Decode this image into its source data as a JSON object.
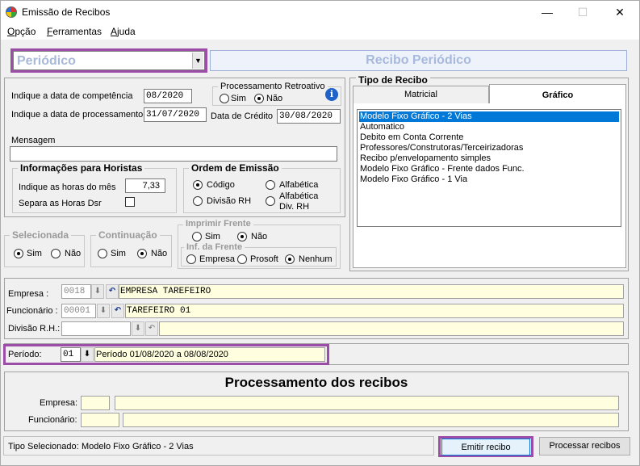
{
  "window": {
    "title": "Emissão de Recibos",
    "minimize": "—",
    "maximize": "☐",
    "close": "✕"
  },
  "menu": {
    "items": [
      {
        "label": "Opção"
      },
      {
        "label": "Ferramentas"
      },
      {
        "label": "Ajuda"
      }
    ]
  },
  "type_combo": {
    "value": "Periódico",
    "arrow": "▼"
  },
  "banner": "Recibo Periódico",
  "dates": {
    "competencia_label": "Indique a data de competência",
    "competencia_value": "08/2020",
    "processamento_label": "Indique a data de processamento",
    "processamento_value": "31/07/2020",
    "credito_label": "Data de Crédito",
    "credito_value": "30/08/2020"
  },
  "retroativo": {
    "title": "Processamento Retroativo",
    "sim": "Sim",
    "nao": "Não",
    "selected": "nao"
  },
  "mensagem": {
    "label": "Mensagem",
    "value": ""
  },
  "horistas": {
    "title": "Informações para Horistas",
    "horas_label": "Indique as horas do mês",
    "horas_value": "7,33",
    "dsr_label": "Separa as Horas Dsr",
    "dsr_checked": false
  },
  "ordem": {
    "title": "Ordem de Emissão",
    "codigo": "Código",
    "alfabetica": "Alfabética",
    "divisao": "Divisão RH",
    "alfabetica_div_1": "Alfabética",
    "alfabetica_div_2": "Div.  RH",
    "selected": "codigo"
  },
  "selecionada": {
    "title": "Selecionada",
    "sim": "Sim",
    "nao": "Não",
    "selected": "sim"
  },
  "continuacao": {
    "title": "Continuação",
    "sim": "Sim",
    "nao": "Não",
    "selected": "nao"
  },
  "imprimir_frente": {
    "title": "Imprimir Frente",
    "sim": "Sim",
    "nao": "Não",
    "selected": "nao",
    "inf_title": "Inf. da Frente",
    "empresa": "Empresa",
    "prosoft": "Prosoft",
    "nenhum": "Nenhum",
    "inf_selected": "nenhum"
  },
  "tipo_recibo": {
    "title": "Tipo de Recibo",
    "tabs": [
      "Matricial",
      "Gráfico"
    ],
    "active_tab": "Gráfico",
    "items": [
      "Modelo Fixo Gráfico - 2 Vias",
      "Automatico",
      "Debito em Conta Corrente",
      "Professores/Construtoras/Terceirizadoras",
      "Recibo p/envelopamento simples",
      "Modelo Fixo Gráfico - Frente dados Func.",
      "Modelo Fixo Gráfico - 1 Via"
    ],
    "selected_index": 0
  },
  "filtros": {
    "empresa_label": "Empresa :",
    "empresa_code": "0018",
    "empresa_name": "EMPRESA TAREFEIRO",
    "funcionario_label": "Funcionário :",
    "funcionario_code": "00001",
    "funcionario_name": "TAREFEIRO 01",
    "divisao_label": "Divisão R.H.:",
    "divisao_code": "",
    "divisao_name": ""
  },
  "periodo": {
    "label": "Período:",
    "code": "01",
    "description": "Período 01/08/2020 a 08/08/2020"
  },
  "processamento": {
    "title": "Processamento dos recibos",
    "empresa_label": "Empresa:",
    "funcionario_label": "Funcionário:"
  },
  "status": {
    "label": "Tipo Selecionado:",
    "value": "Modelo Fixo Gráfico - 2 Vias"
  },
  "buttons": {
    "emitir": "Emitir recibo",
    "processar": "Processar recibos"
  },
  "icons": {
    "info": "i",
    "download": "⬇",
    "undo": "↶"
  }
}
